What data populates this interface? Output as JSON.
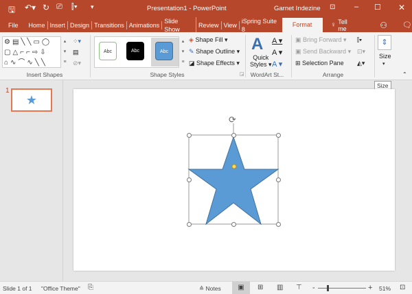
{
  "title": {
    "doc": "Presentation1 - PowerPoint",
    "user": "Garnet Indezine"
  },
  "tabs": [
    "File",
    "Home",
    "Insert",
    "Design",
    "Transitions",
    "Animations",
    "Slide Show",
    "Review",
    "View",
    "iSpring Suite 8",
    "Format"
  ],
  "tell_me": "Tell me",
  "ribbon": {
    "groups": {
      "insert_shapes": "Insert Shapes",
      "shape_styles": "Shape Styles",
      "wordart": "WordArt St...",
      "arrange": "Arrange"
    },
    "style_sample": "Abc",
    "shape_fill": "Shape Fill",
    "shape_outline": "Shape Outline",
    "shape_effects": "Shape Effects",
    "quick_styles": "Quick",
    "quick_styles2": "Styles",
    "bring_forward": "Bring Forward",
    "send_backward": "Send Backward",
    "selection_pane": "Selection Pane",
    "size": "Size"
  },
  "tooltip": "Size",
  "thumb": {
    "number": "1"
  },
  "status": {
    "slide": "Slide 1 of 1",
    "theme": "\"Office Theme\"",
    "notes": "Notes",
    "zoom": "51%",
    "zoom_value": 51
  },
  "colors": {
    "accent": "#b7472a",
    "star": "#5b9bd5"
  }
}
